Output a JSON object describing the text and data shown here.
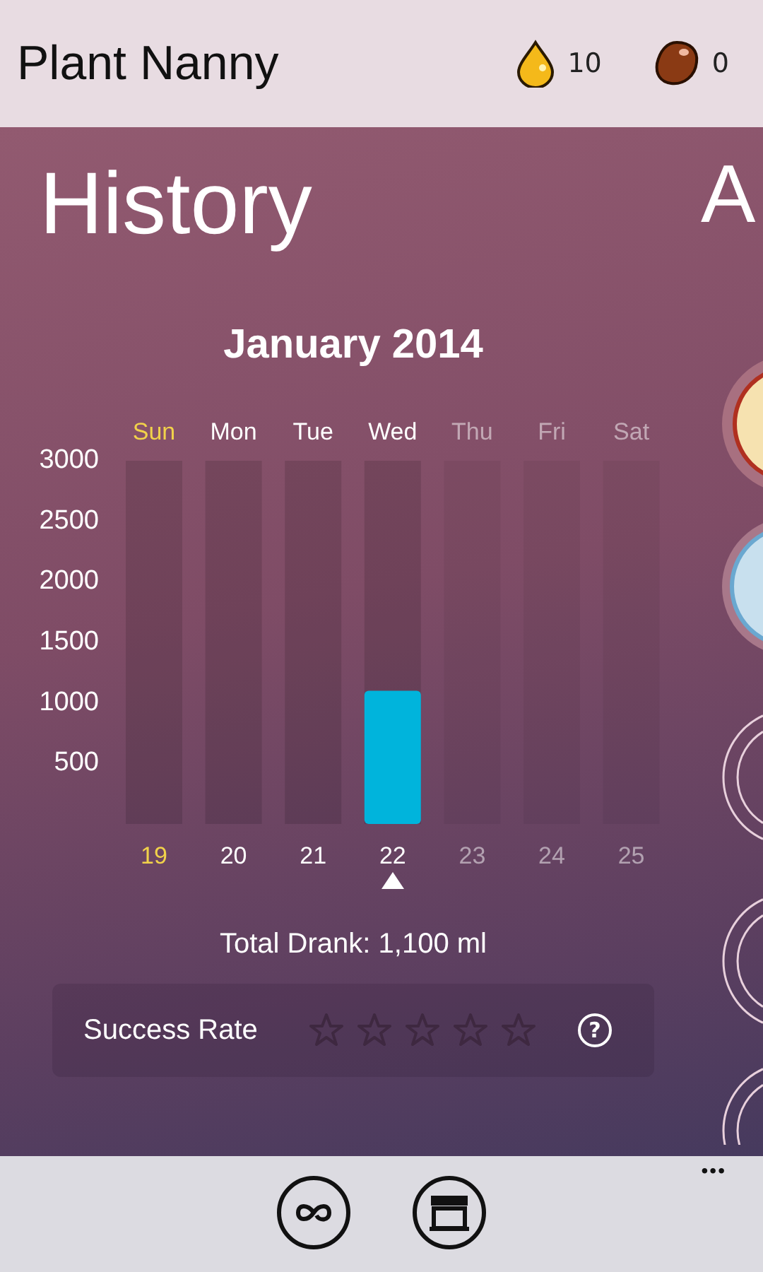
{
  "app_bar": {
    "title": "Plant Nanny",
    "drops": "10",
    "seeds": "0"
  },
  "panel": {
    "title": "History",
    "month": "January 2014"
  },
  "chart_data": {
    "type": "bar",
    "categories": [
      "Sun",
      "Mon",
      "Tue",
      "Wed",
      "Thu",
      "Fri",
      "Sat"
    ],
    "values": [
      0,
      0,
      0,
      1100,
      null,
      null,
      null
    ],
    "ylim": [
      0,
      3000
    ],
    "yticks": [
      500,
      1000,
      1500,
      2000,
      2500,
      3000
    ]
  },
  "day_columns": [
    {
      "date": "19",
      "highlighted": true,
      "selected": false,
      "disabled": false
    },
    {
      "date": "20",
      "highlighted": false,
      "selected": false,
      "disabled": false
    },
    {
      "date": "21",
      "highlighted": false,
      "selected": false,
      "disabled": false
    },
    {
      "date": "22",
      "highlighted": false,
      "selected": true,
      "disabled": false
    },
    {
      "date": "23",
      "highlighted": false,
      "selected": false,
      "disabled": true
    },
    {
      "date": "24",
      "highlighted": false,
      "selected": false,
      "disabled": true
    },
    {
      "date": "25",
      "highlighted": false,
      "selected": false,
      "disabled": true
    }
  ],
  "total": "Total Drank: 1,100 ml",
  "success_rate": {
    "label": "Success Rate",
    "stars": 0,
    "help": "?"
  },
  "next_panel": {
    "title": "A"
  },
  "bottom_bar": {
    "more": "•••"
  }
}
